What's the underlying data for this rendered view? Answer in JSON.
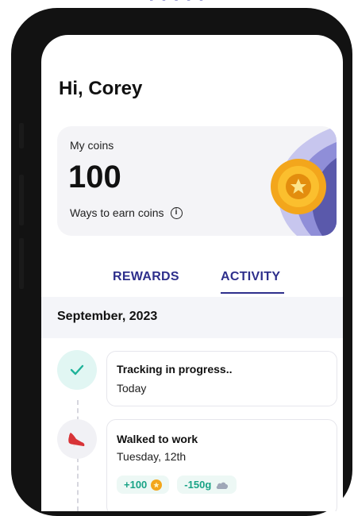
{
  "greeting": "Hi, Corey",
  "coins": {
    "label": "My coins",
    "value": "100",
    "earn_label": "Ways to earn coins",
    "info_glyph": "i"
  },
  "tabs": [
    {
      "label": "REWARDS",
      "active": false
    },
    {
      "label": "ACTIVITY",
      "active": true
    }
  ],
  "month": "September, 2023",
  "activities": [
    {
      "title": "Tracking in progress..",
      "subtitle": "Today",
      "icon": "check-icon"
    },
    {
      "title": "Walked to work",
      "subtitle": "Tuesday, 12th",
      "icon": "shoe-icon",
      "coins_badge": "+100",
      "co2_badge": "-150g"
    }
  ],
  "colors": {
    "primary": "#2e2f8c",
    "accent_green": "#19a386",
    "coin_gold": "#f3a61c"
  }
}
